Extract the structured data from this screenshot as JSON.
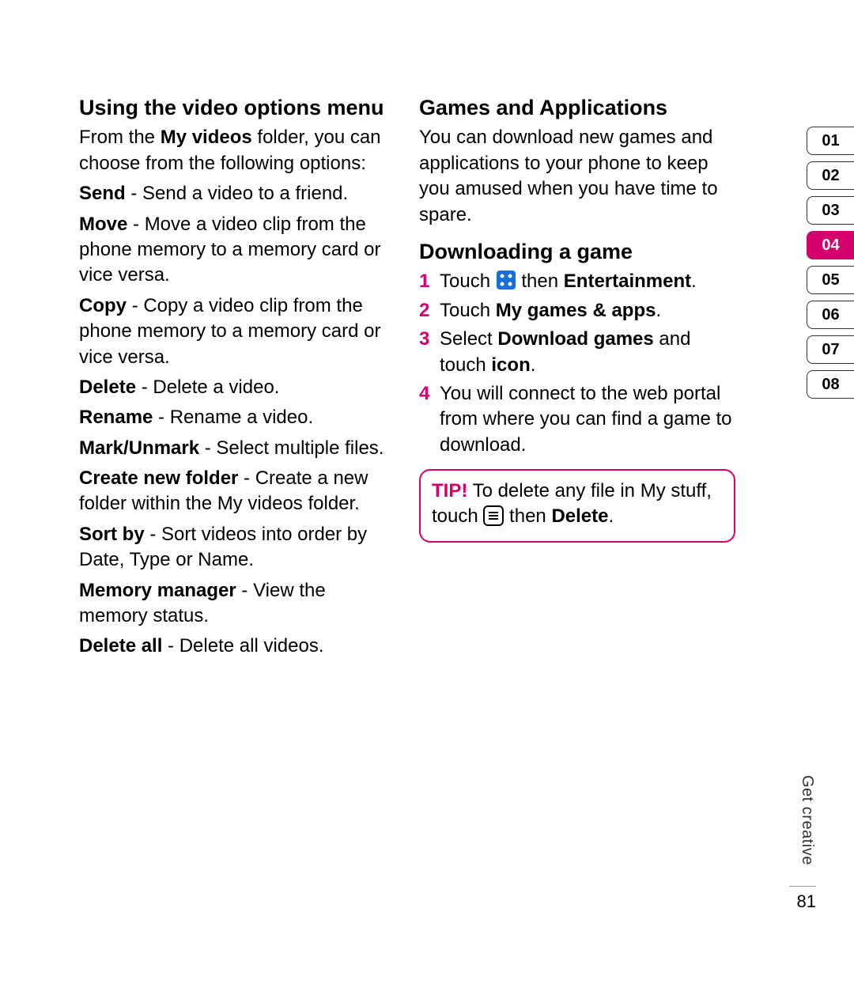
{
  "left": {
    "heading": "Using the video options menu",
    "intro_pre": "From the ",
    "intro_bold": "My videos",
    "intro_post": "  folder, you can choose from the following options:",
    "items": [
      {
        "term": "Send",
        "desc": " - Send a video to a friend."
      },
      {
        "term": "Move",
        "desc": " - Move a video clip from the phone memory to a memory card or vice versa."
      },
      {
        "term": "Copy",
        "desc": " - Copy a video clip from the phone memory to a memory card or vice versa."
      },
      {
        "term": "Delete",
        "desc": " - Delete a video."
      },
      {
        "term": "Rename",
        "desc": " - Rename a video."
      },
      {
        "term": "Mark/Unmark",
        "desc": " - Select multiple files."
      },
      {
        "term": "Create new folder",
        "desc": " - Create a new folder within the My videos folder."
      },
      {
        "term": "Sort by",
        "desc": " - Sort videos into order by Date, Type or Name."
      },
      {
        "term": "Memory manager",
        "desc": " - View the memory status."
      },
      {
        "term": "Delete all",
        "desc": " - Delete all videos."
      }
    ]
  },
  "right": {
    "heading1": "Games and Applications",
    "para1": "You can download new games and applications to your phone to keep you amused when you have time to spare.",
    "heading2": "Downloading a game",
    "steps": {
      "s1_pre": "Touch ",
      "s1_post": " then ",
      "s1_bold": "Entertainment",
      "s1_dot": ".",
      "s2_pre": "Touch ",
      "s2_bold": "My games & apps",
      "s2_dot": ".",
      "s3_pre": "Select ",
      "s3_bold": "Download games",
      "s3_mid": " and touch ",
      "s3_bold2": "icon",
      "s3_dot": ".",
      "s4": "You will connect to the web portal from where you can find a game to download."
    },
    "nums": {
      "n1": "1",
      "n2": "2",
      "n3": "3",
      "n4": "4"
    },
    "tip": {
      "label": "TIP!",
      "pre": " To delete any file in My stuff, touch ",
      "post": " then ",
      "bold": "Delete",
      "dot": "."
    }
  },
  "tabs": [
    "01",
    "02",
    "03",
    "04",
    "05",
    "06",
    "07",
    "08"
  ],
  "active_tab_index": 3,
  "section_label": "Get creative",
  "page_number": "81"
}
